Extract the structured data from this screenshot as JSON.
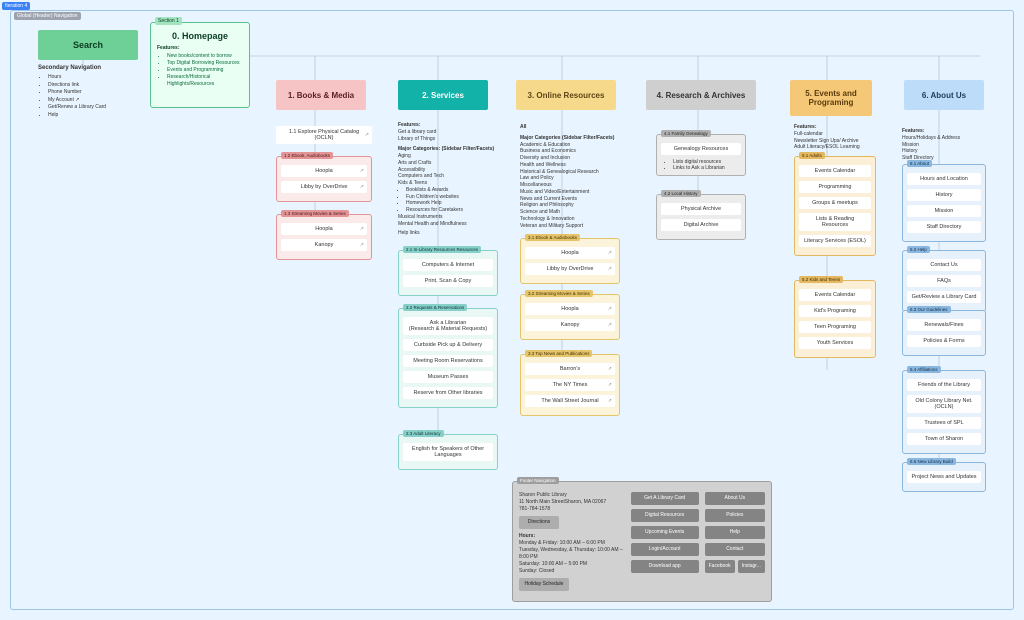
{
  "meta": {
    "tag_top": "Iteration 4"
  },
  "header_nav_label": "Global (Header) Navigation",
  "search": {
    "title": "Search"
  },
  "secondary_nav": {
    "title": "Secondary Navigation",
    "items": [
      "Hours",
      "Directions link",
      "Phone Number",
      "My Account ↗",
      "Get/Renew a Library Card",
      "Help"
    ]
  },
  "homepage": {
    "section_tag": "Section 1",
    "title": "0. Homepage",
    "features_title": "Features:",
    "features": [
      "New books/content to borrow",
      "Top Digital Borrowing Resources",
      "Events and Programming",
      "Research/Historical Highlights/Resources"
    ]
  },
  "topcards": [
    {
      "label": "1.  Books & Media"
    },
    {
      "label": "2.  Services"
    },
    {
      "label": "3.  Online Resources"
    },
    {
      "label": "4.  Research & Archives"
    },
    {
      "label": "5. Events and Programing"
    },
    {
      "label": "6.  About Us"
    }
  ],
  "books_media": {
    "explore": {
      "label": "1.1 Explore Physical Catalog (OCLN)",
      "link": true
    },
    "g1": {
      "label": "1.2 Ebook, Audiobooks",
      "items": [
        {
          "label": "Hoopla",
          "link": true
        },
        {
          "label": "Libby by OverDrive",
          "link": true
        }
      ]
    },
    "g2": {
      "label": "1.3 Streaming Movies & Series",
      "items": [
        {
          "label": "Hoopla",
          "link": true
        },
        {
          "label": "Kanopy",
          "link": true
        }
      ]
    }
  },
  "services": {
    "features_title": "Features:",
    "features": [
      "Get a library card",
      "Library of Things"
    ],
    "cats_title": "Major Categories: (Sidebar Filter/Facets)",
    "cats": [
      "Aging",
      "Arts and Crafts",
      "Accessibility",
      "Computers and Tech",
      "Kids & Teens"
    ],
    "cats_sub": [
      "Booklists & Awards",
      "Fun Children's websites",
      "Homework Help",
      "Resources for Caretakers"
    ],
    "cats2": [
      "Musical Instruments",
      "Mental Health and Mindfulness"
    ],
    "help_links": "Help links",
    "g1": {
      "label": "2.1 In-Library Resources Resources",
      "items": [
        {
          "label": "Computers & Internet"
        },
        {
          "label": "Print, Scan & Copy"
        }
      ]
    },
    "g2": {
      "label": "2.2 Requests & Reservations",
      "items": [
        {
          "label": "Ask a Librarian",
          "sub": "(Research & Material Requests)"
        },
        {
          "label": "Curbside Pick up & Delivery"
        },
        {
          "label": "Meeting Room Reservations"
        },
        {
          "label": "Museum Passes"
        },
        {
          "label": "Reserve from Other libraries"
        }
      ]
    },
    "g3": {
      "label": "2.3 Adult Literacy",
      "items": [
        {
          "label": "English for Speakers of Other Languages"
        }
      ]
    }
  },
  "online": {
    "all": "All",
    "cats_title": "Major Categories (Sidebar Filter/Facets)",
    "cats": [
      "Academic & Education",
      "Business and Economics",
      "Diversity and Inclusion",
      "Health and Wellness",
      "Historical & Genealogical Research",
      "Law and Policy",
      "Miscellaneous",
      "Music and Video/Entertainment",
      "News and Current Events",
      "Religion and Philosophy",
      "Science and Math",
      "Technology & Innovation",
      "Veteran and Military Support"
    ],
    "g1": {
      "label": "3.1 Ebook & Audiobooks",
      "items": [
        {
          "label": "Hoopla",
          "link": true
        },
        {
          "label": "Libby by OverDrive",
          "link": true
        }
      ]
    },
    "g2": {
      "label": "3.2 Streaming Movies & Series",
      "items": [
        {
          "label": "Hoopla",
          "link": true
        },
        {
          "label": "Kanopy",
          "link": true
        }
      ]
    },
    "g3": {
      "label": "3.3 Top News and Publications",
      "items": [
        {
          "label": "Barron's",
          "link": true
        },
        {
          "label": "The NY Times",
          "link": true
        },
        {
          "label": "The Wall Street Journal",
          "link": true
        }
      ]
    }
  },
  "research": {
    "g1": {
      "label": "4.1 Family Genealogy",
      "items": [
        {
          "label": "Genealogy Resources",
          "bullets": [
            "Lists digital resources",
            "Links to Ask a Librarian"
          ]
        }
      ]
    },
    "g2": {
      "label": "4.2 Local History",
      "items": [
        {
          "label": "Physical Archive"
        },
        {
          "label": "Digital Archive"
        }
      ]
    }
  },
  "events": {
    "features_title": "Features:",
    "features": [
      "Full-calendar",
      "Newsletter Sign Ups/ Archive",
      "Adult Literacy/ESOL Learning"
    ],
    "g1": {
      "label": "5.1 Adults",
      "items": [
        {
          "label": "Events Calendar"
        },
        {
          "label": "Programming"
        },
        {
          "label": "Groups & meetups"
        },
        {
          "label": "Lists & Reading Resources"
        },
        {
          "label": "Literacy Services (ESOL)"
        }
      ]
    },
    "g2": {
      "label": "5.2 Kids and Teens",
      "items": [
        {
          "label": "Events Calendar"
        },
        {
          "label": "Kid's Programing"
        },
        {
          "label": "Teen Programing"
        },
        {
          "label": "Youth Services"
        }
      ]
    }
  },
  "about": {
    "features_title": "Features:",
    "features": [
      "Hours/Holidays & Address",
      "Mission",
      "History",
      "Staff Directory"
    ],
    "g1": {
      "label": "6.1 About",
      "items": [
        {
          "label": "Hours and Location"
        },
        {
          "label": "History"
        },
        {
          "label": "Mission"
        },
        {
          "label": "Staff Directory"
        }
      ]
    },
    "g2": {
      "label": "6.2 Help",
      "items": [
        {
          "label": "Contact Us"
        },
        {
          "label": "FAQs"
        },
        {
          "label": "Get/Review a Library Card"
        }
      ]
    },
    "g3": {
      "label": "6.3 Our Guidelines",
      "items": [
        {
          "label": "Renewals/Fines"
        },
        {
          "label": "Policies & Forms"
        }
      ]
    },
    "g4": {
      "label": "6.4 Affiliations",
      "items": [
        {
          "label": "Friends of the Library"
        },
        {
          "label": "Old Colony Library Net. (OCLN)"
        },
        {
          "label": "Trustees of SPL"
        },
        {
          "label": "Town of Sharon"
        }
      ]
    },
    "g5": {
      "label": "6.5 New Library Build",
      "items": [
        {
          "label": "Project News and Updates"
        }
      ]
    }
  },
  "footer": {
    "label": "Footer Navigation",
    "address": [
      "Sharon Public Library",
      "11 North Main StreetSharon, MA 02067",
      "781-784-1578"
    ],
    "directions": "Directions",
    "hours_title": "Hours:",
    "hours": [
      "Monday & Friday: 10:00 AM – 6:00 PM",
      "Tuesday, Wednesday, & Thursday: 10:00 AM – 8:00 PM",
      "Saturday: 10:00 AM – 5:00 PM",
      "Sunday: Closed"
    ],
    "holiday": "Holiday Schedule",
    "col2": [
      "Get A Library Card",
      "Digital Resources",
      "Upcoming Events",
      "Login/Account",
      "Download app"
    ],
    "col3": [
      "About Us",
      "Policies",
      "Help",
      "Contact"
    ],
    "social": [
      "Facebook",
      "Instagr..."
    ]
  }
}
